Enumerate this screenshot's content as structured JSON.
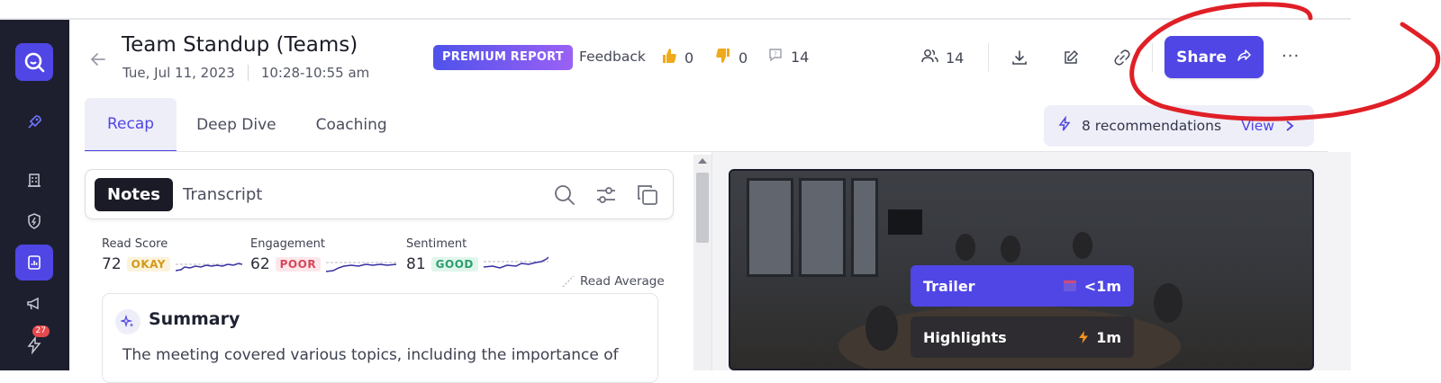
{
  "header": {
    "title": "Team Standup (Teams)",
    "date": "Tue, Jul 11, 2023",
    "time": "10:28-10:55 am",
    "premium_label": "PREMIUM REPORT",
    "feedback_label": "Feedback",
    "thumbs_up_count": "0",
    "thumbs_down_count": "0",
    "comments_count": "14",
    "participants_count": "14",
    "share_label": "Share",
    "more_label": "···"
  },
  "tabs": [
    {
      "label": "Recap",
      "active": true
    },
    {
      "label": "Deep Dive",
      "active": false
    },
    {
      "label": "Coaching",
      "active": false
    }
  ],
  "recommendations": {
    "text": "8 recommendations",
    "view_label": "View"
  },
  "notes_bar": {
    "notes_label": "Notes",
    "transcript_label": "Transcript"
  },
  "metrics": [
    {
      "label": "Read Score",
      "value": "72",
      "status": "OKAY"
    },
    {
      "label": "Engagement",
      "value": "62",
      "status": "POOR"
    },
    {
      "label": "Sentiment",
      "value": "81",
      "status": "GOOD"
    }
  ],
  "read_average_label": "Read Average",
  "summary": {
    "title": "Summary",
    "text": "The meeting covered various topics, including the importance of"
  },
  "video": {
    "trailer_label": "Trailer",
    "trailer_duration": "<1m",
    "highlights_label": "Highlights",
    "highlights_duration": "1m"
  },
  "sidebar": {
    "notification_badge": "27"
  },
  "colors": {
    "accent": "#4f46e5",
    "sidebar_bg": "#1d1f2e",
    "annotation_red": "#e01f26"
  },
  "icons": [
    "logo-icon",
    "rocket-icon",
    "building-icon",
    "shield-icon",
    "report-icon",
    "megaphone-icon",
    "lightning-icon",
    "back-arrow-icon",
    "thumbs-up-icon",
    "thumbs-down-icon",
    "comment-icon",
    "users-icon",
    "download-icon",
    "edit-icon",
    "link-icon",
    "share-arrow-icon",
    "more-icon",
    "search-icon",
    "filter-icon",
    "copy-icon",
    "sparkle-icon"
  ]
}
